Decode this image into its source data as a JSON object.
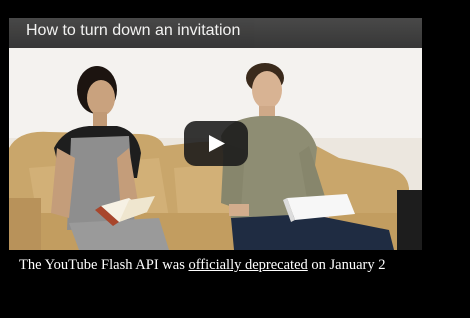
{
  "video": {
    "title": "How to turn down an invitation",
    "play_icon": "play-icon"
  },
  "notice": {
    "prefix": "The YouTube Flash API was ",
    "link_text": "officially deprecated",
    "suffix": " on January 2"
  },
  "colors": {
    "background": "#000000",
    "title_bar": "#2e2e2e",
    "play_button": "#191919",
    "wall": "#f4f2ef",
    "sofa": "#c9a66b"
  }
}
